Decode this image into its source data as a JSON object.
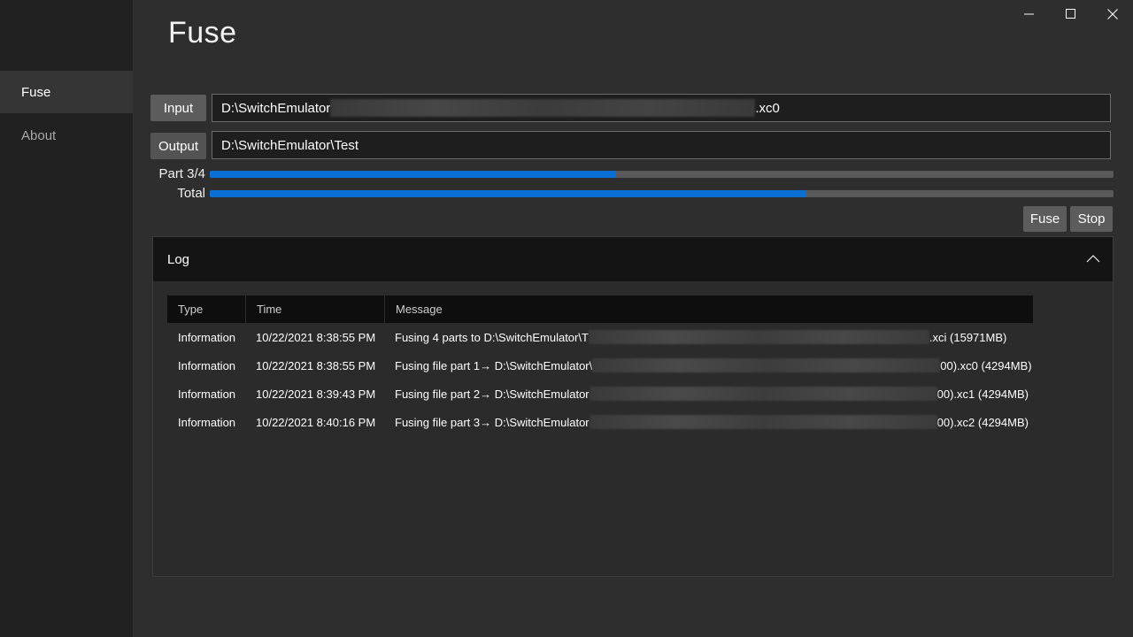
{
  "window": {
    "title": "Fuse",
    "caption": {
      "minimize_icon": "minimize-icon",
      "maximize_icon": "maximize-icon",
      "close_icon": "close-icon"
    }
  },
  "sidebar": {
    "items": [
      {
        "label": "Fuse",
        "selected": true
      },
      {
        "label": "About",
        "selected": false
      }
    ]
  },
  "form": {
    "input_button": "Input",
    "input_value_start": "D:\\SwitchEmulator",
    "input_value_end": ".xc0",
    "output_button": "Output",
    "output_value": "D:\\SwitchEmulator\\Test"
  },
  "progress": {
    "part_label": "Part 3/4",
    "part_fraction": 0.45,
    "total_label": "Total",
    "total_fraction": 0.66,
    "accent_color": "#0a6fd4"
  },
  "actions": {
    "fuse_label": "Fuse",
    "stop_label": "Stop"
  },
  "log": {
    "header": "Log",
    "expanded": true,
    "columns": [
      "Type",
      "Time",
      "Message"
    ],
    "rows": [
      {
        "type": "Information",
        "time": "10/22/2021 8:38:55 PM",
        "msg_start": "Fusing 4 parts to D:\\SwitchEmulator\\T",
        "msg_end": ".xci  (15971MB)"
      },
      {
        "type": "Information",
        "time": "10/22/2021 8:38:55 PM",
        "msg_start": "Fusing file part 1→ D:\\SwitchEmulator\\",
        "msg_end": "00).xc0 (4294MB)"
      },
      {
        "type": "Information",
        "time": "10/22/2021 8:39:43 PM",
        "msg_start": "Fusing file part 2→ D:\\SwitchEmulator",
        "msg_end": "00).xc1 (4294MB)"
      },
      {
        "type": "Information",
        "time": "10/22/2021 8:40:16 PM",
        "msg_start": "Fusing file part 3→ D:\\SwitchEmulator",
        "msg_end": "00).xc2 (4294MB)"
      }
    ]
  }
}
